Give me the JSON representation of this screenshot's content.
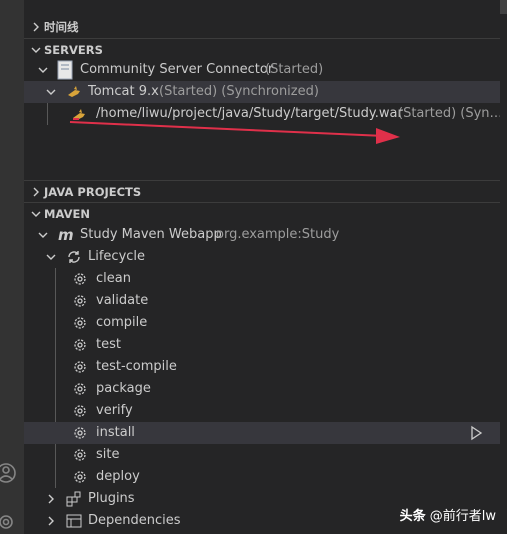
{
  "timeline": {
    "title": "时间线"
  },
  "servers": {
    "title": "SERVERS",
    "connector": {
      "name": "Community Server Connector",
      "status": "(Started)"
    },
    "tomcat": {
      "name": "Tomcat 9.x",
      "status": "(Started) (Synchronized)"
    },
    "deployment": {
      "path": "/home/liwu/project/java/Study/target/Study.war",
      "status": "(Started) (Syn…"
    }
  },
  "java_projects": {
    "title": "JAVA PROJECTS"
  },
  "maven": {
    "title": "MAVEN",
    "project": {
      "name": "Study Maven Webapp",
      "coords": "org.example:Study"
    },
    "lifecycle": {
      "label": "Lifecycle",
      "phases": [
        "clean",
        "validate",
        "compile",
        "test",
        "test-compile",
        "package",
        "verify",
        "install",
        "site",
        "deploy"
      ]
    },
    "plugins_label": "Plugins",
    "dependencies_label": "Dependencies"
  },
  "watermark": {
    "prefix": "头条",
    "handle": "@前行者lw"
  },
  "colors": {
    "accent_arrow": "#e0304a",
    "selection": "#37373d",
    "background": "#252526"
  }
}
